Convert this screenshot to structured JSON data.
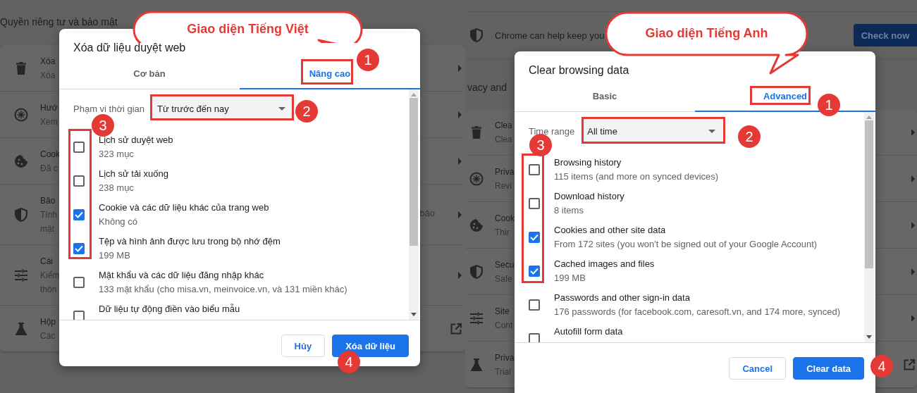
{
  "panels": [
    {
      "settings": {
        "heading": "Quyền riêng tư và bảo mật",
        "rows": [
          {
            "lines": [
              "Xóa",
              "Xóa"
            ]
          },
          {
            "lines": [
              "Hướ",
              "Xem"
            ]
          },
          {
            "lines": [
              "Cook",
              "Đã c"
            ]
          },
          {
            "lines": [
              "Bảo",
              "Tính",
              "mật"
            ],
            "trailing_text": "bảo"
          },
          {
            "lines": [
              "Cài",
              "Kiểm",
              "thôn"
            ]
          },
          {
            "lines": [
              "Hộp",
              "Các"
            ]
          }
        ]
      },
      "dialog": {
        "title": "Xóa dữ liệu duyệt web",
        "tabs": [
          {
            "label": "Cơ bản",
            "selected": false
          },
          {
            "label": "Nâng cao",
            "selected": true
          }
        ],
        "time_range": {
          "label": "Phạm vi thời gian",
          "value": "Từ trước đến nay"
        },
        "items": [
          {
            "label": "Lịch sử duyệt web",
            "detail": "323 mục",
            "checked": false
          },
          {
            "label": "Lịch sử tải xuống",
            "detail": "238 mục",
            "checked": false
          },
          {
            "label": "Cookie và các dữ liệu khác của trang web",
            "detail": "Không có",
            "checked": true
          },
          {
            "label": "Tệp và hình ảnh được lưu trong bộ nhớ đệm",
            "detail": "199 MB",
            "checked": true
          },
          {
            "label": "Mật khẩu và các dữ liệu đăng nhập khác",
            "detail": "133 mật khẩu (cho misa.vn, meinvoice.vn, và 131 miền khác)",
            "checked": false
          },
          {
            "label": "Dữ liệu tự động điền vào biểu mẫu",
            "checked": false
          }
        ],
        "buttons": [
          {
            "label": "Hủy",
            "kind": "cancel"
          },
          {
            "label": "Xóa dữ liệu",
            "kind": "primary"
          }
        ]
      },
      "callout": "Giao diện Tiếng Việt",
      "markers": [
        "1",
        "2",
        "3",
        "4"
      ]
    },
    {
      "settings": {
        "safety_check": {
          "text": "Chrome can help keep you",
          "button": "Check now"
        },
        "heading": "vacy and",
        "rows": [
          {
            "lines": [
              "Clea",
              "Clea"
            ]
          },
          {
            "lines": [
              "Priva",
              "Revi"
            ]
          },
          {
            "lines": [
              "Cook",
              "Thir"
            ]
          },
          {
            "lines": [
              "Secu",
              "Safe"
            ]
          },
          {
            "lines": [
              "Site",
              "Cont"
            ]
          },
          {
            "lines": [
              "Priva",
              "Trial"
            ]
          }
        ]
      },
      "dialog": {
        "title": "Clear browsing data",
        "tabs": [
          {
            "label": "Basic",
            "selected": false
          },
          {
            "label": "Advanced",
            "selected": true
          }
        ],
        "time_range": {
          "label": "Time range",
          "value": "All time"
        },
        "items": [
          {
            "label": "Browsing history",
            "detail": "115 items (and more on synced devices)",
            "checked": false
          },
          {
            "label": "Download history",
            "detail": "8 items",
            "checked": false
          },
          {
            "label": "Cookies and other site data",
            "detail": "From 172 sites (you won't be signed out of your Google Account)",
            "checked": true
          },
          {
            "label": "Cached images and files",
            "detail": "199 MB",
            "checked": true
          },
          {
            "label": "Passwords and other sign-in data",
            "detail": "176 passwords (for facebook.com, caresoft.vn, and 174 more, synced)",
            "checked": false
          },
          {
            "label": "Autofill form data",
            "checked": false
          }
        ],
        "buttons": [
          {
            "label": "Cancel",
            "kind": "cancel"
          },
          {
            "label": "Clear data",
            "kind": "primary"
          }
        ]
      },
      "callout": "Giao diện Tiếng Anh",
      "markers": [
        "1",
        "2",
        "3",
        "4"
      ]
    }
  ]
}
